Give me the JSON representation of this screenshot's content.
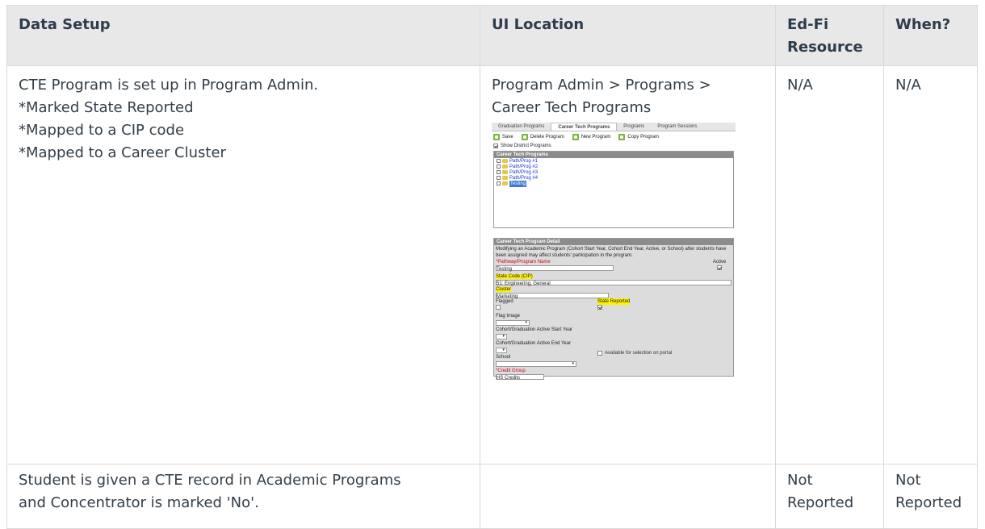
{
  "table": {
    "headers": [
      "Data Setup",
      "UI Location",
      "Ed-Fi Resource",
      "When?"
    ],
    "headers_wrapped": {
      "ed_fi_line1": "Ed-Fi",
      "ed_fi_line2": "Resource"
    },
    "rows": [
      {
        "data_setup": [
          "CTE Program is set up in Program Admin.",
          "*Marked State Reported",
          "*Mapped to a CIP code",
          "*Mapped to a Career Cluster"
        ],
        "ui_location": [
          "Program Admin > Programs >",
          "Career Tech Programs"
        ],
        "ed_fi_resource": "N/A",
        "when": "N/A"
      },
      {
        "data_setup": [
          "Student is given a CTE record in Academic Programs",
          "and Concentrator is marked 'No'."
        ],
        "ui_location": [],
        "ed_fi_resource": [
          "Not",
          "Reported"
        ],
        "when": [
          "Not",
          "Reported"
        ]
      }
    ]
  },
  "screenshot": {
    "tabs": [
      "Graduation Programs",
      "Career Tech Programs",
      "Programs",
      "Program Sessions"
    ],
    "active_tab": "Career Tech Programs",
    "toolbar": [
      "Save",
      "Delete Program",
      "New Program",
      "Copy Program"
    ],
    "show_district": "Show District Programs",
    "tree_header": "Career Tech Programs",
    "tree_items": [
      "Path/Prog #1",
      "Path/Prog #2",
      "Path/Prog #3",
      "Path/Prog #4",
      "Testing"
    ],
    "detail": {
      "header": "Career Tech Program Detail",
      "note": "Modifying an Academic Program (Cohort Start Year, Cohort End Year, Active, or School) after students have been assigned may affect students' participation in the program.",
      "name_label": "*Pathway/Program Name",
      "name_value": "Testing",
      "active_label": "Active",
      "cip_label": "State Code (CIP)",
      "cip_value": "51: Engineering, General",
      "cluster_label": "Cluster",
      "cluster_value": "Marketing",
      "flagged_label": "Flagged",
      "state_reported_label": "State Reported",
      "flag_image_label": "Flag Image",
      "start_year_label": "Cohort/Graduation Active Start Year",
      "end_year_label": "Cohort/Graduation Active End Year",
      "school_label": "School",
      "portal_label": "Available for selection on portal",
      "credit_group_label": "*Credit Group",
      "credit_group_value": "HS Credits"
    }
  }
}
